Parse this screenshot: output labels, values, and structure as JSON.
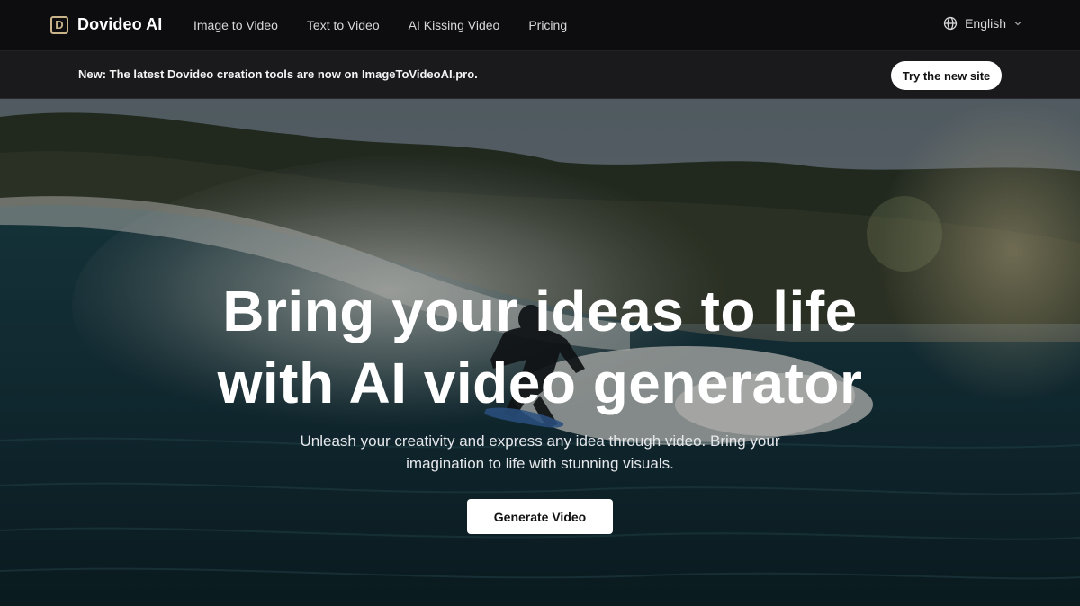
{
  "brand": {
    "logo_letter": "D",
    "name": "Dovideo AI"
  },
  "nav": {
    "links": [
      "Image to Video",
      "Text to Video",
      "AI Kissing Video",
      "Pricing"
    ],
    "language": "English",
    "icons": {
      "language": "globe-icon",
      "dropdown": "chevron-down-icon"
    }
  },
  "announcement": {
    "text": "New: The latest Dovideo creation tools are now on ImageToVideoAI.pro.",
    "button_label": "Try the new site"
  },
  "hero": {
    "title_line1": "Bring your ideas to life",
    "title_line2": "with AI video generator",
    "subtitle_line1": "Unleash your creativity and express any idea through video. Bring your",
    "subtitle_line2": "imagination to life with stunning visuals.",
    "cta_label": "Generate Video"
  },
  "colors": {
    "nav_bg": "#0d0d0f",
    "announce_bg": "#1a1a1c",
    "logo_accent": "#c9b48a"
  }
}
